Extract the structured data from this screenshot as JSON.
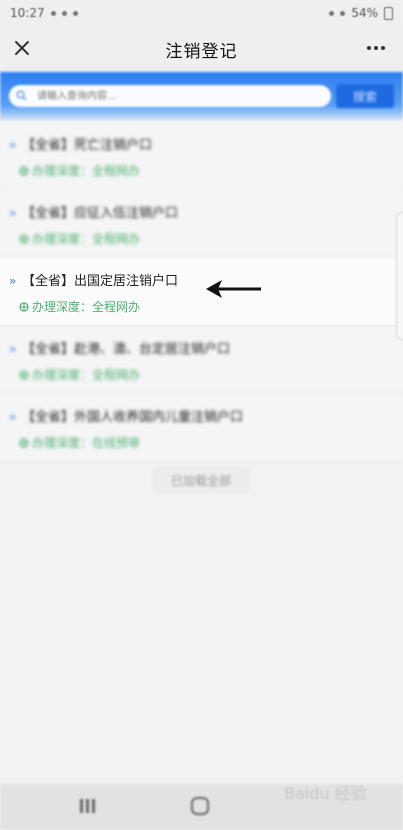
{
  "status_bar": {
    "time": "10:27",
    "battery": "54%"
  },
  "header": {
    "title": "注销登记"
  },
  "search": {
    "placeholder": "请输入查询内容...",
    "button_label": "搜索"
  },
  "items": [
    {
      "title": "【全省】死亡注销户口",
      "depth": "办理深度：全程网办"
    },
    {
      "title": "【全省】应征入伍注销户口",
      "depth": "办理深度：全程网办"
    },
    {
      "title": "【全省】出国定居注销户口",
      "depth": "办理深度：全程网办"
    },
    {
      "title": "【全省】赴港、澳、台定居注销户口",
      "depth": "办理深度：全程网办"
    },
    {
      "title": "【全省】外国人收养国内儿童注销户口",
      "depth": "办理深度：在线预审"
    }
  ],
  "footer": {
    "loaded_text": "已加载全部"
  },
  "watermark": {
    "text": "Baidu 经验"
  },
  "colors": {
    "accent": "#2b7ef2",
    "depth_green": "#4caf72",
    "chevron_blue": "#4a7ad8"
  }
}
